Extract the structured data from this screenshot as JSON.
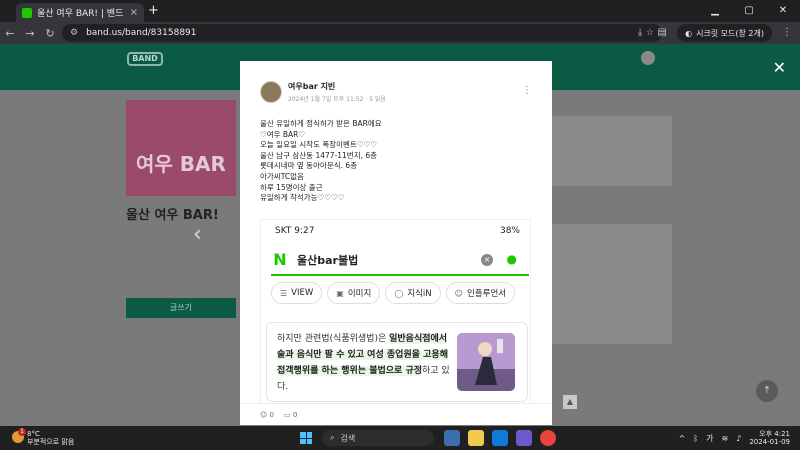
{
  "browser": {
    "tab_title": "울산 여우 BAR! | 밴드",
    "tab_close": "×",
    "new_tab": "+",
    "url": "band.us/band/83158891",
    "incognito_label": "시크릿 모드(창 2개)",
    "win_controls": [
      "▁",
      "▢",
      "✕"
    ]
  },
  "background": {
    "logo": "BAND",
    "band_title": "울산 여우 BAR!",
    "banner_text": "여우 BAR",
    "write_button": "글쓰기"
  },
  "post": {
    "author": "여우bar 지빈",
    "date": "2024년 1월 7일 오후 11:52 · 5 읽음",
    "more": "⋮",
    "lines": [
      "울산 유일하게 정식허가 받은 BAR에요",
      "♡여우 BAR♡",
      "오늘 일요일 시작도 폭장이벤트♡♡♡",
      "울산 남구 삼산동 1477-11번지, 6층",
      "롯데시네마 옆 동아아문식.  6층",
      "아가씨TC없음",
      "하루 15명이상 출근",
      "유일하게 착석가능♡♡♡♡"
    ],
    "footer_emotions": "0",
    "footer_comments": "0"
  },
  "screenshot": {
    "status_time": "SKT 9:27",
    "status_right": "38%",
    "search_query": "울산bar불법",
    "n_logo": "N",
    "chips": [
      {
        "icon": "☰",
        "label": "VIEW"
      },
      {
        "icon": "▣",
        "label": "이미지"
      },
      {
        "icon": "◯",
        "label": "지식iN"
      },
      {
        "icon": "☺",
        "label": "인플루언서"
      }
    ],
    "card_text_parts": {
      "p1": "하지만 관련법(식품위생법)은 ",
      "p2": "일반음식점에서 술과 음식만 팔 수 있고 여성 종업원을 고용해 접객행위를 하는 행위는 불법으로 규정",
      "p3": "하고 있다."
    }
  },
  "taskbar": {
    "weather_temp": "8°C",
    "weather_desc": "부분적으로 맑음",
    "weather_badge": "1",
    "search_label": "검색",
    "tray_lang": "가",
    "time": "오후 4:21",
    "date": "2024-01-09"
  },
  "colors": {
    "band_green": "#0a5a44",
    "naver_green": "#1ec800"
  }
}
